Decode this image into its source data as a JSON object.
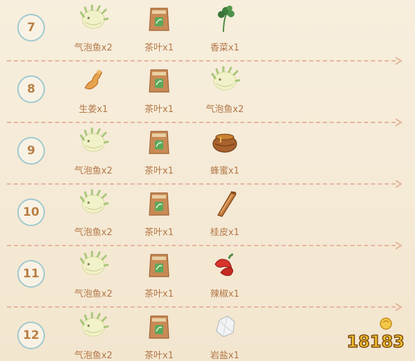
{
  "rows": [
    {
      "number": "7",
      "items": [
        {
          "icon": "pufferfish-icon",
          "label": "气泡鱼x2"
        },
        {
          "icon": "tea-bag-icon",
          "label": "茶叶x1"
        },
        {
          "icon": "coriander-icon",
          "label": "香菜x1"
        }
      ]
    },
    {
      "number": "8",
      "items": [
        {
          "icon": "ginger-icon",
          "label": "生姜x1"
        },
        {
          "icon": "tea-bag-icon",
          "label": "茶叶x1"
        },
        {
          "icon": "pufferfish-icon",
          "label": "气泡鱼x2"
        }
      ]
    },
    {
      "number": "9",
      "items": [
        {
          "icon": "pufferfish-icon",
          "label": "气泡鱼x2"
        },
        {
          "icon": "tea-bag-icon",
          "label": "茶叶x1"
        },
        {
          "icon": "honey-pot-icon",
          "label": "蜂蜜x1"
        }
      ]
    },
    {
      "number": "10",
      "items": [
        {
          "icon": "pufferfish-icon",
          "label": "气泡鱼x2"
        },
        {
          "icon": "tea-bag-icon",
          "label": "茶叶x1"
        },
        {
          "icon": "cinnamon-icon",
          "label": "桂皮x1"
        }
      ]
    },
    {
      "number": "11",
      "items": [
        {
          "icon": "pufferfish-icon",
          "label": "气泡鱼x2"
        },
        {
          "icon": "tea-bag-icon",
          "label": "茶叶x1"
        },
        {
          "icon": "chili-pepper-icon",
          "label": "辣椒x1"
        }
      ]
    },
    {
      "number": "12",
      "items": [
        {
          "icon": "pufferfish-icon",
          "label": "气泡鱼x2"
        },
        {
          "icon": "tea-bag-icon",
          "label": "茶叶x1"
        },
        {
          "icon": "rock-salt-icon",
          "label": "岩盐x1"
        }
      ]
    }
  ],
  "watermark": {
    "text": "18183",
    "icon": "18183-logo-icon"
  },
  "colors": {
    "background": "#f6ecd9",
    "badge_border": "#9fc9cf",
    "badge_text": "#b97f45",
    "label_text": "#b37748",
    "divider": "#e3b69b"
  }
}
